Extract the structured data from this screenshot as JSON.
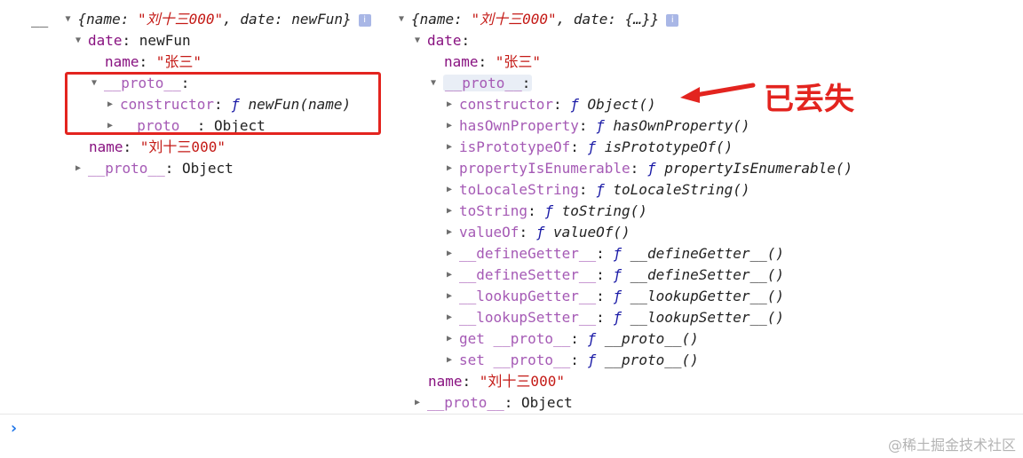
{
  "left": {
    "prefix": "__",
    "summary": {
      "open": "{",
      "name_key": "name",
      "name_value": "\"刘十三000\"",
      "date_key": "date",
      "date_value": "newFun",
      "close": "}"
    },
    "info_icon": "i",
    "rows": {
      "date_key": "date",
      "date_value": "newFun",
      "inner_name_key": "name",
      "inner_name_value": "\"张三\"",
      "proto_key": "__proto__",
      "constructor_key": "constructor",
      "constructor_f": "ƒ",
      "constructor_value": "newFun(name)",
      "inner_proto_key": "__proto__",
      "inner_proto_value": "Object",
      "outer_name_key": "name",
      "outer_name_value": "\"刘十三000\"",
      "outer_proto_key": "__proto__",
      "outer_proto_value": "Object"
    }
  },
  "right": {
    "summary": {
      "open": "{",
      "name_key": "name",
      "name_value": "\"刘十三000\"",
      "date_key": "date",
      "date_value": "{…}",
      "close": "}"
    },
    "info_icon": "i",
    "date_key": "date",
    "inner_name_key": "name",
    "inner_name_value": "\"张三\"",
    "proto_key": "__proto__",
    "methods": [
      {
        "key": "constructor",
        "f": "ƒ",
        "value": "Object()"
      },
      {
        "key": "hasOwnProperty",
        "f": "ƒ",
        "value": "hasOwnProperty()"
      },
      {
        "key": "isPrototypeOf",
        "f": "ƒ",
        "value": "isPrototypeOf()"
      },
      {
        "key": "propertyIsEnumerable",
        "f": "ƒ",
        "value": "propertyIsEnumerable()"
      },
      {
        "key": "toLocaleString",
        "f": "ƒ",
        "value": "toLocaleString()"
      },
      {
        "key": "toString",
        "f": "ƒ",
        "value": "toString()"
      },
      {
        "key": "valueOf",
        "f": "ƒ",
        "value": "valueOf()"
      },
      {
        "key": "__defineGetter__",
        "f": "ƒ",
        "value": "__defineGetter__()"
      },
      {
        "key": "__defineSetter__",
        "f": "ƒ",
        "value": "__defineSetter__()"
      },
      {
        "key": "__lookupGetter__",
        "f": "ƒ",
        "value": "__lookupGetter__()"
      },
      {
        "key": "__lookupSetter__",
        "f": "ƒ",
        "value": "__lookupSetter__()"
      },
      {
        "key": "get __proto__",
        "f": "ƒ",
        "value": "__proto__()"
      },
      {
        "key": "set __proto__",
        "f": "ƒ",
        "value": "__proto__()"
      }
    ],
    "outer_name_key": "name",
    "outer_name_value": "\"刘十三000\"",
    "outer_proto_key": "__proto__",
    "outer_proto_value": "Object"
  },
  "annotation": "已丢失",
  "prompt_symbol": "›",
  "watermark": "@稀土掘金技术社区",
  "colors": {
    "key": "#881280",
    "proto_key": "#a55ab5",
    "string": "#c41a16",
    "function": "#1a1aa6",
    "annotation": "#e3241f"
  }
}
